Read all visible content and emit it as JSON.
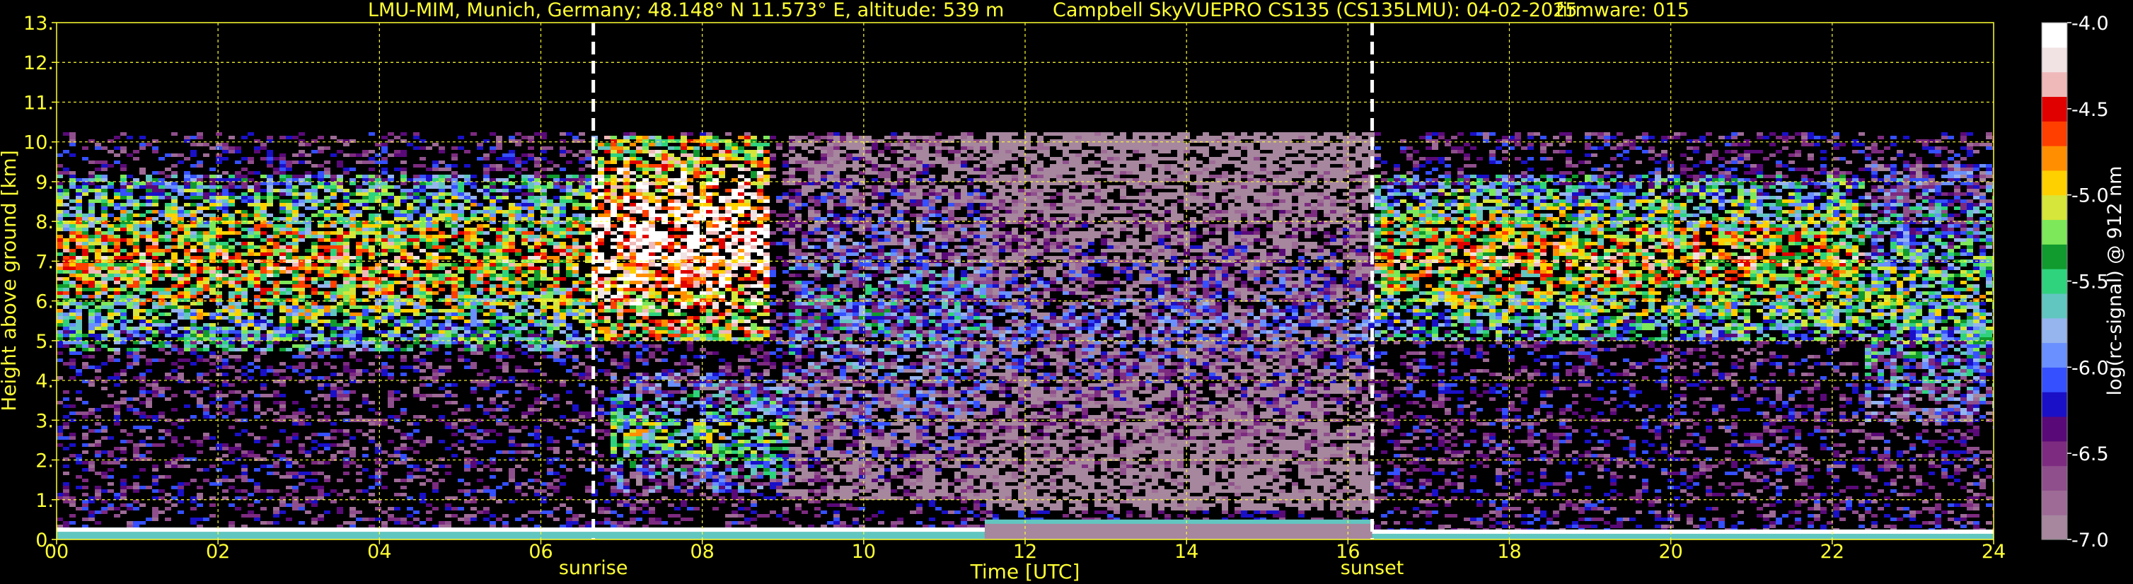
{
  "header": {
    "station": "LMU-MIM, Munich, Germany; 48.148° N 11.573° E, altitude: 539 m",
    "instrument": "Campbell SkyVUEPRO CS135 (CS135LMU): 04-02-2025",
    "firmware": "firmware: 015"
  },
  "chart_data": {
    "type": "heatmap",
    "title": "LMU-MIM, Munich, Germany; 48.148° N 11.573° E, altitude: 539 m    Campbell SkyVUEPRO CS135 (CS135LMU): 04-02-2025    firmware: 015",
    "xlabel": "Time [UTC]",
    "ylabel": "Height above ground [km]",
    "colorbar_label": "log(rc-signal) @ 912 nm",
    "xlim": [
      0,
      24
    ],
    "ylim": [
      0,
      13
    ],
    "x_ticks": [
      0,
      2,
      4,
      6,
      8,
      10,
      12,
      14,
      16,
      18,
      20,
      22,
      24
    ],
    "x_tick_labels": [
      "00",
      "02",
      "04",
      "06",
      "08",
      "10",
      "12",
      "14",
      "16",
      "18",
      "20",
      "22",
      "24"
    ],
    "y_ticks": [
      0,
      1,
      2,
      3,
      4,
      5,
      6,
      7,
      8,
      9,
      10,
      11,
      12,
      13
    ],
    "y_tick_labels": [
      "0.",
      "1.",
      "2.",
      "3.",
      "4.",
      "5.",
      "6.",
      "7.",
      "8.",
      "9.",
      "10.",
      "11.",
      "12.",
      "13."
    ],
    "grid": true,
    "colorbar_range": [
      -7.0,
      -4.0
    ],
    "colorbar_ticks": [
      -7.0,
      -6.5,
      -6.0,
      -5.5,
      -5.0,
      -4.5,
      -4.0
    ],
    "colorbar_tick_labels": [
      "-7.0",
      "-6.5",
      "-6.0",
      "-5.5",
      "-5.0",
      "-4.5",
      "-4.0"
    ],
    "colormap": [
      "#a6879e",
      "#9e6b96",
      "#8f4f8c",
      "#7d2b80",
      "#5a0a78",
      "#1a10c8",
      "#3550ff",
      "#6a90ff",
      "#96b4ee",
      "#62c6c0",
      "#2fd37d",
      "#119a2e",
      "#7de85a",
      "#d6e63a",
      "#ffd000",
      "#ff8f00",
      "#ff3f00",
      "#e00000",
      "#f0b9b9",
      "#f1e3e3",
      "#ffffff"
    ],
    "events": [
      {
        "label": "sunrise",
        "x": 6.65
      },
      {
        "label": "sunset",
        "x": 16.3
      }
    ],
    "signal_top_km": 10.25,
    "cloud_layers": [
      {
        "t0": 0.0,
        "t1": 6.6,
        "z0": 4.8,
        "z1": 9.2,
        "level": -5.0
      },
      {
        "t0": 6.6,
        "t1": 8.8,
        "z0": 5.0,
        "z1": 10.2,
        "level": -4.2
      },
      {
        "t0": 6.8,
        "t1": 9.8,
        "z0": 1.2,
        "z1": 4.2,
        "level": -5.6
      },
      {
        "t0": 9.0,
        "t1": 11.5,
        "z0": 1.0,
        "z1": 10.2,
        "level": -6.2
      },
      {
        "t0": 11.5,
        "t1": 16.3,
        "z0": 0.8,
        "z1": 10.25,
        "level": -6.6
      },
      {
        "t0": 16.3,
        "t1": 22.4,
        "z0": 5.0,
        "z1": 9.2,
        "level": -5.0
      },
      {
        "t0": 22.4,
        "t1": 24.0,
        "z0": 3.0,
        "z1": 9.5,
        "level": -5.6
      }
    ],
    "surface_layer": [
      {
        "t0": 0.0,
        "t1": 11.5,
        "z1": 0.3,
        "level": -4.1
      },
      {
        "t0": 11.5,
        "t1": 16.3,
        "z1": 0.5,
        "level": -5.6
      },
      {
        "t0": 16.3,
        "t1": 24.0,
        "z1": 0.25,
        "level": -4.1
      }
    ]
  }
}
